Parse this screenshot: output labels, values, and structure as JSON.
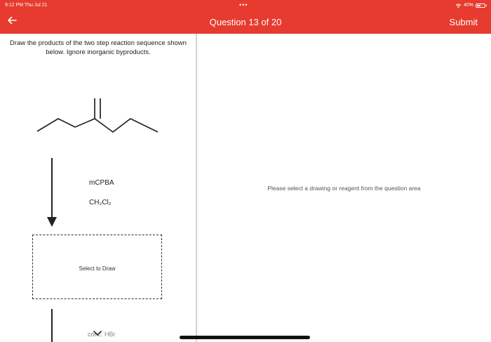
{
  "status_bar": {
    "time": "9:12 PM  Thu Jul 21",
    "battery": "40%"
  },
  "header": {
    "dots": "•••",
    "title": "Question 13 of 20",
    "submit_label": "Submit"
  },
  "question_panel": {
    "instructions": "Draw the products of the two step reaction sequence shown below. Ignore inorganic byproducts.",
    "step1_reagents": [
      "mCPBA",
      "CH₂Cl₂"
    ],
    "draw_box_label": "Select to Draw",
    "step2_reagent": "conc. HBr"
  },
  "drawing_area": {
    "placeholder": "Please select a drawing or reagent from the question area"
  },
  "colors": {
    "header_bg": "#e63b2e",
    "divider": "#d4d4d4"
  },
  "icons": {
    "back": "arrow-left-icon",
    "wifi": "wifi-icon",
    "battery": "battery-icon",
    "chevron": "chevron-down-icon"
  }
}
